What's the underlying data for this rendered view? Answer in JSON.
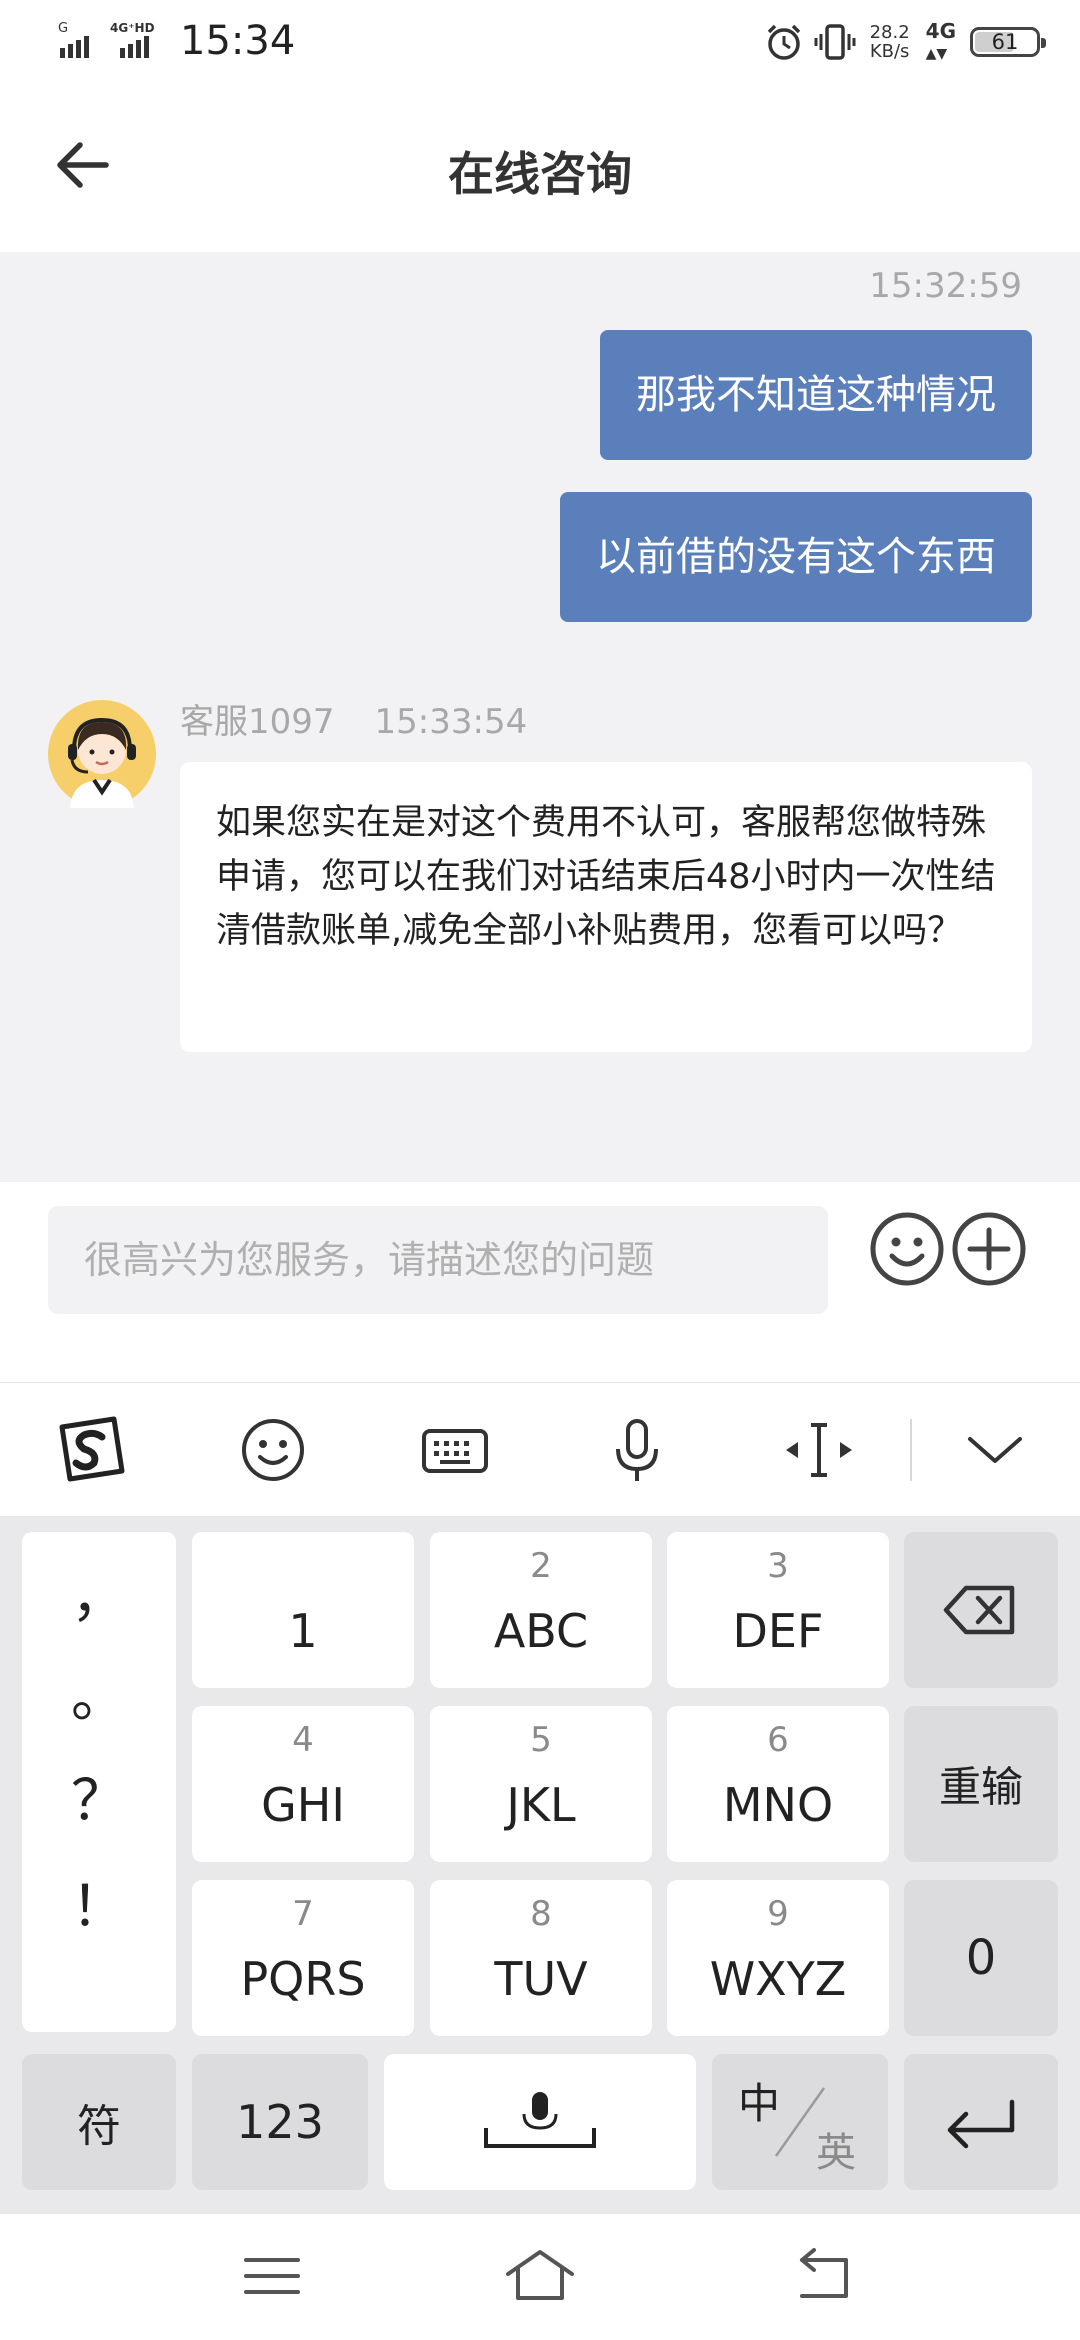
{
  "status_bar": {
    "time": "15:34",
    "signal_label_1": "G",
    "signal_label_2": "4G⁺HD",
    "speed_value": "28.2",
    "speed_unit": "KB/s",
    "network": "4G",
    "battery": "61"
  },
  "header": {
    "title": "在线咨询"
  },
  "chat": {
    "timestamp": "15:32:59",
    "outgoing": [
      "那我不知道这种情况",
      "以前借的没有这个东西"
    ],
    "agent": {
      "name": "客服1097",
      "time": "15:33:54",
      "message": "如果您实在是对这个费用不认可，客服帮您做特殊申请，您可以在我们对话结束后48小时内一次性结清借款账单,减免全部小补贴费用，您看可以吗？"
    }
  },
  "input": {
    "placeholder": "很高兴为您服务，请描述您的问题"
  },
  "keyboard": {
    "punct": [
      "，",
      "。",
      "？",
      "！"
    ],
    "keys": [
      {
        "num": "",
        "label": "1"
      },
      {
        "num": "2",
        "label": "ABC"
      },
      {
        "num": "3",
        "label": "DEF"
      },
      {
        "num": "4",
        "label": "GHI"
      },
      {
        "num": "5",
        "label": "JKL"
      },
      {
        "num": "6",
        "label": "MNO"
      },
      {
        "num": "7",
        "label": "PQRS"
      },
      {
        "num": "8",
        "label": "TUV"
      },
      {
        "num": "9",
        "label": "WXYZ"
      }
    ],
    "retype": "重输",
    "zero": "0",
    "symbols": "符",
    "numeric": "123",
    "lang_zh": "中",
    "lang_en": "英"
  },
  "icons": {
    "back": "back-arrow-icon",
    "emoji": "emoji-icon",
    "plus": "plus-icon",
    "sogou": "sogou-logo-icon",
    "keyboard": "keyboard-icon",
    "mic": "microphone-icon",
    "cursor": "cursor-move-icon",
    "collapse": "chevron-down-icon",
    "backspace": "backspace-icon",
    "enter": "enter-icon",
    "space": "space-mic-icon",
    "menu": "menu-icon",
    "home": "home-icon",
    "return": "return-icon"
  },
  "colors": {
    "outgoing_bubble": "#5b7fbb",
    "chat_background": "#f2f2f4",
    "keyboard_background": "#e9e9ec"
  }
}
